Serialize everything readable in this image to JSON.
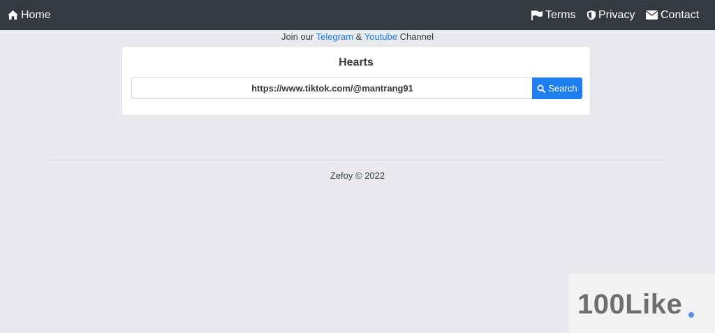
{
  "navbar": {
    "home_label": "Home",
    "terms_label": "Terms",
    "privacy_label": "Privacy",
    "contact_label": "Contact"
  },
  "announcement": {
    "prefix": "Join our ",
    "telegram_link": "Telegram",
    "ampersand": " & ",
    "youtube_link": "Youtube",
    "suffix": " Channel"
  },
  "card": {
    "title": "Hearts",
    "url_input_value": "https://www.tiktok.com/@mantrang91",
    "search_button_label": "Search"
  },
  "footer": {
    "text": "Zefoy © 2022"
  },
  "watermark": {
    "text": "100Like"
  },
  "colors": {
    "navbar_bg": "#343a40",
    "page_bg": "#e9eaee",
    "link": "#1a7ae8",
    "button": "#1f7ef0",
    "watermark_dot": "#5b8ee6"
  }
}
